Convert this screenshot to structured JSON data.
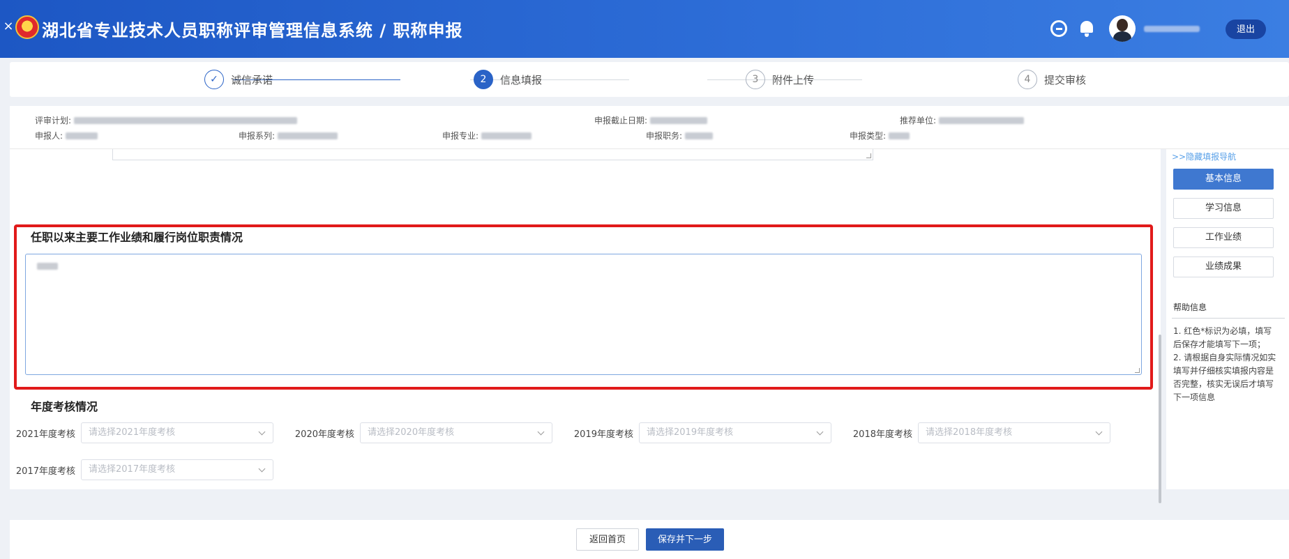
{
  "header": {
    "close_glyph": "×",
    "title": "湖北省专业技术人员职称评审管理信息系统 / 职称申报",
    "logout_label": "退出",
    "icons": [
      "close-icon",
      "emblem-logo",
      "search-icon",
      "bell-icon",
      "avatar"
    ]
  },
  "steps": [
    {
      "mark": "✓",
      "label": "诚信承诺",
      "state": "done"
    },
    {
      "mark": "2",
      "label": "信息填报",
      "state": "active"
    },
    {
      "mark": "3",
      "label": "附件上传",
      "state": "pending"
    },
    {
      "mark": "4",
      "label": "提交审核",
      "state": "pending"
    }
  ],
  "info": {
    "plan_label": "评审计划:",
    "deadline_label": "申报截止日期:",
    "recommender_label": "推荐单位:",
    "applicant_label": "申报人:",
    "series_label": "申报系列:",
    "specialty_label": "申报专业:",
    "position_label": "申报职务:",
    "type_label": "申报类型:"
  },
  "main": {
    "section_title": "任职以来主要工作业绩和履行岗位职责情况",
    "annual_title": "年度考核情况",
    "annual": [
      {
        "label": "2021年度考核",
        "placeholder": "请选择2021年度考核"
      },
      {
        "label": "2020年度考核",
        "placeholder": "请选择2020年度考核"
      },
      {
        "label": "2019年度考核",
        "placeholder": "请选择2019年度考核"
      },
      {
        "label": "2018年度考核",
        "placeholder": "请选择2018年度考核"
      },
      {
        "label": "2017年度考核",
        "placeholder": "请选择2017年度考核"
      }
    ]
  },
  "rnav": {
    "hide_link": ">>隐藏填报导航",
    "items": [
      "基本信息",
      "学习信息",
      "工作业绩",
      "业绩成果"
    ],
    "help_title": "帮助信息",
    "help_1": "1. 红色*标识为必填，填写后保存才能填写下一项；",
    "help_2": "2. 请根据自身实际情况如实填写并仔细核实填报内容是否完整，核实无误后才填写下一项信息"
  },
  "footer": {
    "home_label": "返回首页",
    "save_label": "保存并下一步"
  },
  "colors": {
    "header_blue": "#2e6ed8",
    "accent_blue": "#2a63c7",
    "highlight_red": "#e11a1a",
    "nav_active": "#3f78d0"
  }
}
